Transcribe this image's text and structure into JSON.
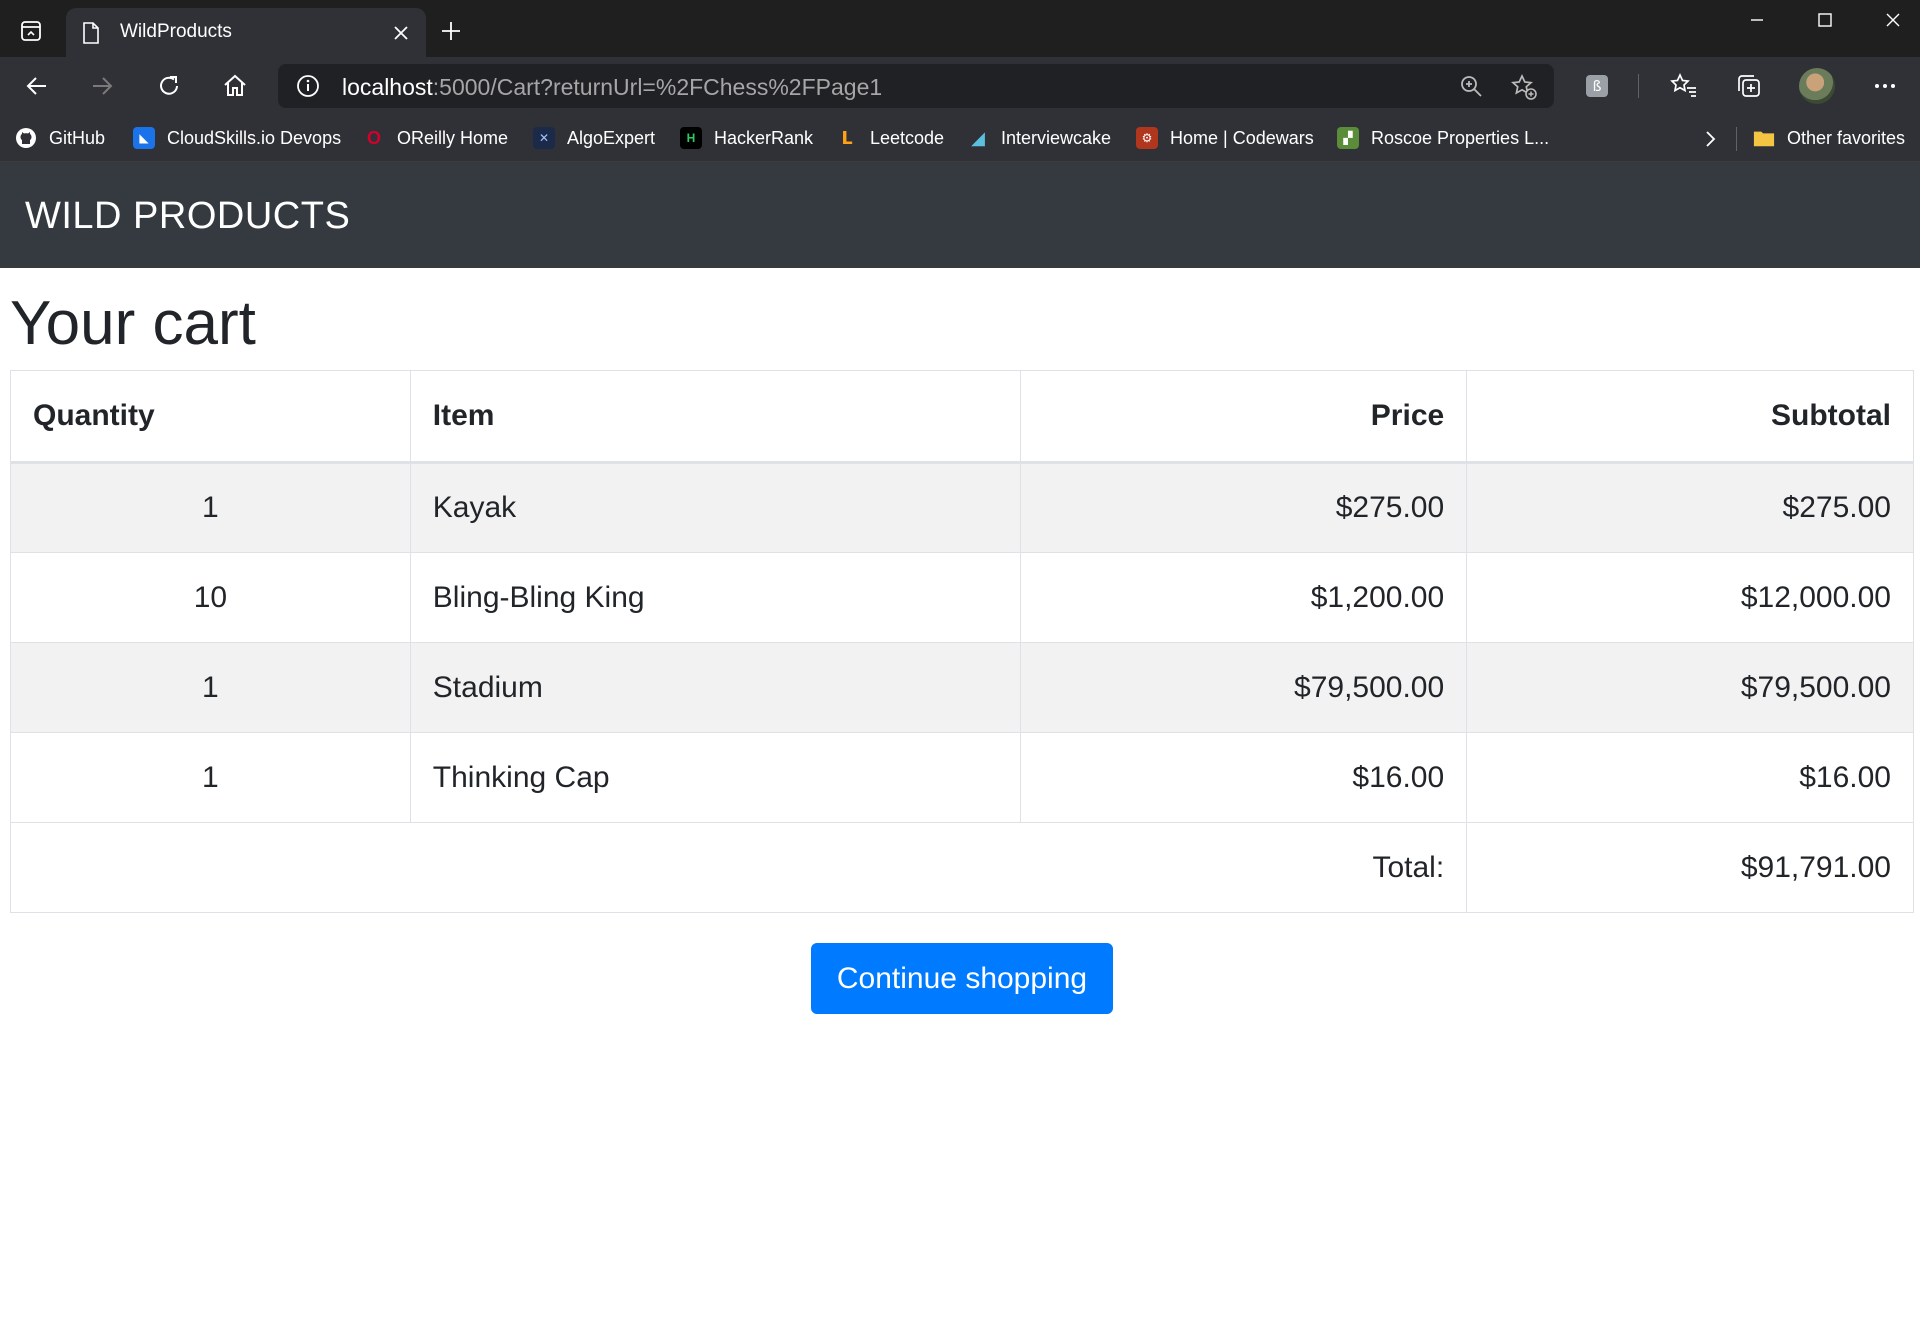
{
  "browser": {
    "tab": {
      "title": "WildProducts"
    },
    "address": {
      "host": "localhost",
      "rest": ":5000/Cart?returnUrl=%2FChess%2FPage1"
    },
    "bookmarks": [
      {
        "label": "GitHub",
        "icon": "github-icon"
      },
      {
        "label": "CloudSkills.io Devops",
        "icon": "cloudskills-icon"
      },
      {
        "label": "OReilly Home",
        "icon": "oreilly-icon"
      },
      {
        "label": "AlgoExpert",
        "icon": "algoexpert-icon"
      },
      {
        "label": "HackerRank",
        "icon": "hackerrank-icon"
      },
      {
        "label": "Leetcode",
        "icon": "leetcode-icon"
      },
      {
        "label": "Interviewcake",
        "icon": "interviewcake-icon"
      },
      {
        "label": "Home | Codewars",
        "icon": "codewars-icon"
      },
      {
        "label": "Roscoe Properties L...",
        "icon": "roscoe-icon"
      }
    ],
    "other_favorites": "Other favorites"
  },
  "navbar": {
    "brand": "WILD PRODUCTS"
  },
  "page": {
    "title": "Your cart"
  },
  "cart": {
    "headers": {
      "quantity": "Quantity",
      "item": "Item",
      "price": "Price",
      "subtotal": "Subtotal"
    },
    "rows": [
      {
        "quantity": "1",
        "item": "Kayak",
        "price": "$275.00",
        "subtotal": "$275.00"
      },
      {
        "quantity": "10",
        "item": "Bling-Bling King",
        "price": "$1,200.00",
        "subtotal": "$12,000.00"
      },
      {
        "quantity": "1",
        "item": "Stadium",
        "price": "$79,500.00",
        "subtotal": "$79,500.00"
      },
      {
        "quantity": "1",
        "item": "Thinking Cap",
        "price": "$16.00",
        "subtotal": "$16.00"
      }
    ],
    "total_label": "Total:",
    "total_value": "$91,791.00"
  },
  "actions": {
    "continue_label": "Continue shopping"
  },
  "colors": {
    "navbar": "#343a40",
    "primary": "#007bff",
    "stripe": "#f2f2f2"
  }
}
